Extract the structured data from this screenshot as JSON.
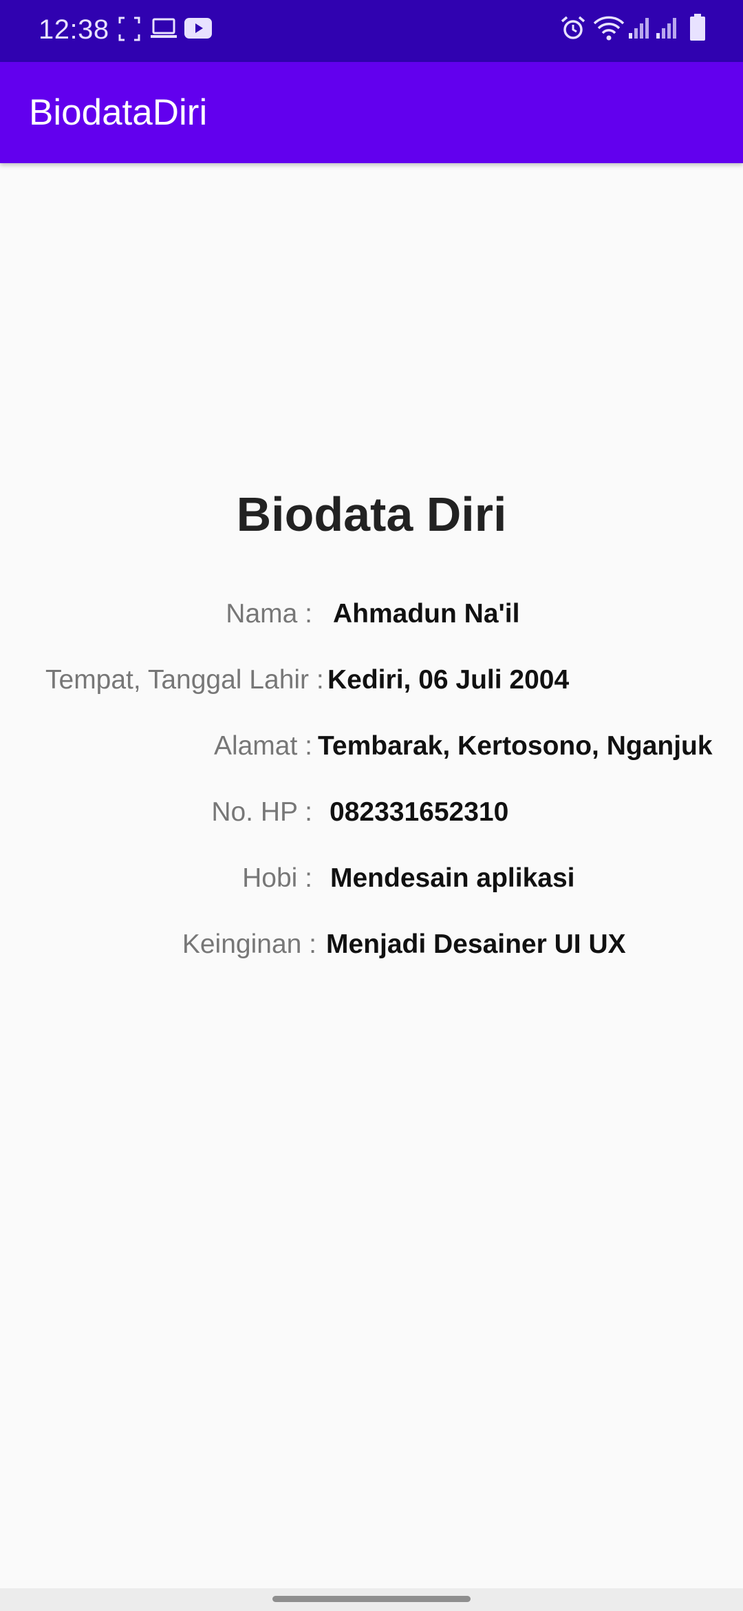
{
  "status_bar": {
    "time": "12:38",
    "icons_left": [
      "screenshot-frame-icon",
      "laptop-icon",
      "youtube-icon"
    ],
    "icons_right": [
      "alarm-icon",
      "wifi-icon",
      "signal-icon",
      "signal-icon",
      "battery-icon"
    ]
  },
  "app_bar": {
    "title": "BiodataDiri",
    "color": "#6200ee"
  },
  "main": {
    "heading": "Biodata Diri",
    "rows": [
      {
        "label": "Nama :",
        "value": "Ahmadun Na'il"
      },
      {
        "label": "Tempat, Tanggal Lahir :",
        "value": "Kediri, 06 Juli 2004"
      },
      {
        "label": "Alamat :",
        "value": "Tembarak, Kertosono, Nganjuk"
      },
      {
        "label": "No. HP :",
        "value": "082331652310"
      },
      {
        "label": "Hobi :",
        "value": "Mendesain aplikasi"
      },
      {
        "label": "Keinginan :",
        "value": "Menjadi Desainer UI UX"
      }
    ]
  },
  "colors": {
    "status_bar": "#3002b0",
    "app_bar": "#6200ee",
    "background": "#fafafa"
  }
}
